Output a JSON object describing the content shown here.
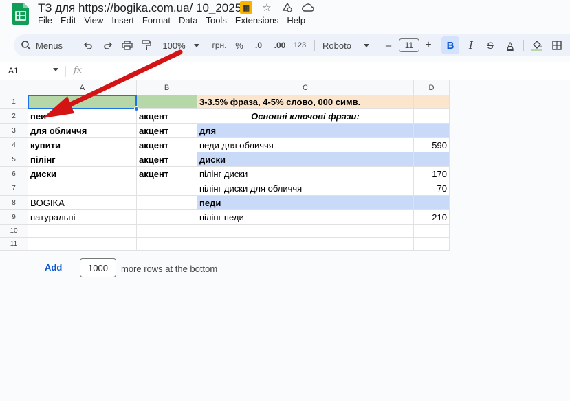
{
  "window": {
    "title": "ТЗ для https://bogika.com.ua/ 10_2025",
    "icons": [
      "move-to-folder-icon",
      "star-icon",
      "offline-icon",
      "cloud-saved-icon"
    ]
  },
  "menu": [
    "File",
    "Edit",
    "View",
    "Insert",
    "Format",
    "Data",
    "Tools",
    "Extensions",
    "Help"
  ],
  "toolbar": {
    "search_label": "Menus",
    "zoom": "100%",
    "currency": "грн.",
    "percent": "%",
    "decrease_decimals": ".0",
    "increase_decimals": ".00",
    "number_format": "123",
    "font": "Roboto",
    "font_size": "11",
    "minus": "–",
    "plus": "+",
    "bold": "B",
    "italic": "I",
    "strikethrough": "S",
    "text_color": "A"
  },
  "formula_bar": {
    "cell_ref": "A1",
    "fx": "fx",
    "value": ""
  },
  "columns": [
    "A",
    "B",
    "C",
    "D"
  ],
  "rows": [
    {
      "num": "1",
      "a": "",
      "b": "",
      "c": "3-3.5% фраза, 4-5% слово, 000 симв.",
      "d": ""
    },
    {
      "num": "2",
      "a": "пеи",
      "b": "акцент",
      "c": "Основні ключові фрази:",
      "d": ""
    },
    {
      "num": "3",
      "a": "для обличчя",
      "b": "акцент",
      "c": "для",
      "d": ""
    },
    {
      "num": "4",
      "a": "купити",
      "b": "акцент",
      "c": "педи для обличчя",
      "d": "590"
    },
    {
      "num": "5",
      "a": "пілінг",
      "b": "акцент",
      "c": "диски",
      "d": ""
    },
    {
      "num": "6",
      "a": "диски",
      "b": "акцент",
      "c": "пілінг диски",
      "d": "170"
    },
    {
      "num": "7",
      "a": "",
      "b": "",
      "c": "пілінг диски для обличчя",
      "d": "70"
    },
    {
      "num": "8",
      "a": "BOGIKA",
      "b": "",
      "c": "педи",
      "d": ""
    },
    {
      "num": "9",
      "a": "натуральні",
      "b": "",
      "c": "пілінг педи",
      "d": "210"
    },
    {
      "num": "10",
      "a": "",
      "b": "",
      "c": "",
      "d": ""
    },
    {
      "num": "11",
      "a": "",
      "b": "",
      "c": "",
      "d": ""
    }
  ],
  "colors": {
    "green_fill": "#b6d7a8",
    "orange_fill": "#fce5cd",
    "blue_fill": "#c9daf8",
    "selection": "#1a73e8",
    "arrow": "#d41414"
  },
  "add_rows": {
    "button": "Add",
    "count": "1000",
    "suffix": "more rows at the bottom"
  }
}
